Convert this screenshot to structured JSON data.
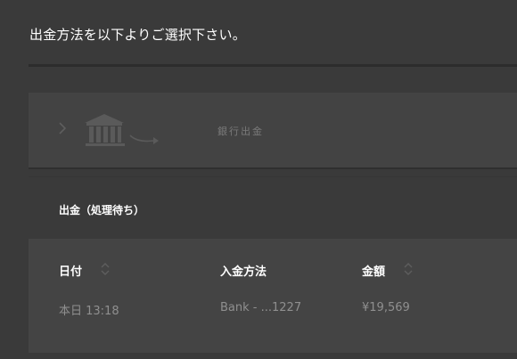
{
  "page": {
    "title": "出金方法を以下よりご選択下さい。"
  },
  "methods": [
    {
      "label": "銀行出金",
      "icon": "bank-icon"
    }
  ],
  "pending": {
    "title": "出金（処理待ち）",
    "columns": [
      "日付",
      "入金方法",
      "金額"
    ],
    "rows": [
      {
        "date": "本日 13:18",
        "method": "Bank - ...1227",
        "amount": "¥19,569"
      }
    ]
  },
  "colors": {
    "background": "#3a3a3a",
    "card": "#434343",
    "muted_text": "#8f8f8f"
  }
}
